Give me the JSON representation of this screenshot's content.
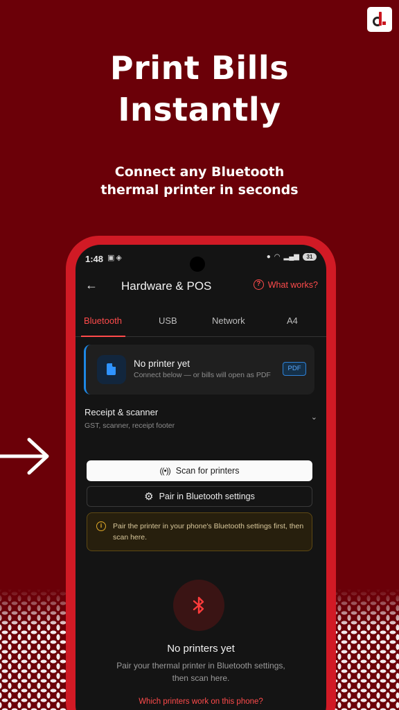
{
  "promo": {
    "headline_line1": "Print Bills",
    "headline_line2": "Instantly",
    "subhead_line1": "Connect any Bluetooth",
    "subhead_line2": "thermal printer in seconds"
  },
  "status_bar": {
    "time": "1:48",
    "battery": "31"
  },
  "appbar": {
    "title": "Hardware & POS",
    "help_label": "What works?"
  },
  "tabs": [
    {
      "label": "Bluetooth"
    },
    {
      "label": "USB"
    },
    {
      "label": "Network"
    },
    {
      "label": "A4"
    }
  ],
  "printer_card": {
    "title": "No printer yet",
    "subtitle": "Connect below — or bills will open as PDF",
    "badge": "PDF"
  },
  "receipt_section": {
    "title": "Receipt & scanner",
    "subtitle": "GST, scanner, receipt footer"
  },
  "actions": {
    "scan_label": "Scan for printers",
    "pair_label": "Pair in Bluetooth settings"
  },
  "info": {
    "text": "Pair the printer in your phone's Bluetooth settings first, then scan here."
  },
  "empty_state": {
    "title": "No printers yet",
    "subtitle": "Pair your thermal printer in Bluetooth settings, then scan here.",
    "link": "Which printers work on this phone?"
  },
  "colors": {
    "background": "#6b0008",
    "phone_frame": "#d11a25",
    "accent": "#ff4b4b",
    "pdf_blue": "#2f93ff",
    "warning": "#e0a928"
  }
}
